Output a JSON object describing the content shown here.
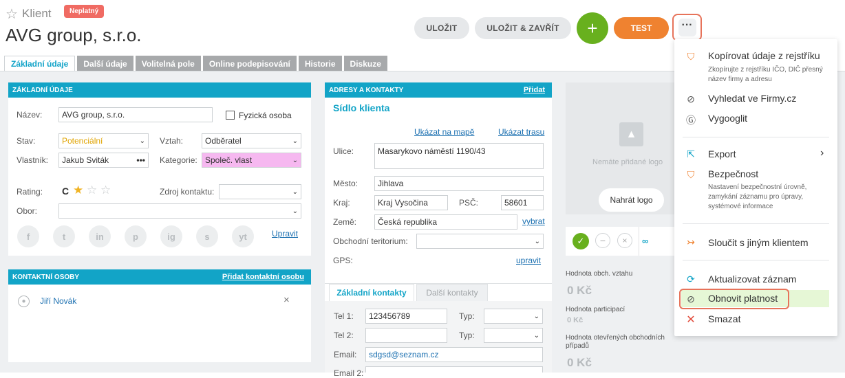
{
  "header": {
    "star_icon": "☆",
    "entity_label": "Klient",
    "status_badge": "Neplatný",
    "client_name": "AVG group, s.r.o.",
    "buttons": {
      "save": "ULOŽIT",
      "save_close": "ULOŽIT & ZAVŘÍT",
      "add": "+",
      "test": "TEST",
      "more": "···"
    },
    "tabs": [
      "Základní údaje",
      "Další údaje",
      "Volitelná pole",
      "Online podepisování",
      "Historie",
      "Diskuze"
    ]
  },
  "basic": {
    "title": "ZÁKLADNÍ ÚDAJE",
    "name_label": "Název:",
    "name_value": "AVG group, s.r.o.",
    "physical_label": "Fyzická osoba",
    "state_label": "Stav:",
    "state_value": "Potenciální",
    "relation_label": "Vztah:",
    "relation_value": "Odběratel",
    "owner_label": "Vlastník:",
    "owner_value": "Jakub Sviták",
    "category_label": "Kategorie:",
    "category_value": "Společ. vlast",
    "rating_label": "Rating:",
    "rating_value": "C",
    "rating_stars": 1,
    "source_label": "Zdroj kontaktu:",
    "field_label": "Obor:",
    "edit_link": "Upravit",
    "social": [
      "f",
      "t",
      "in",
      "p",
      "ig",
      "s",
      "yt"
    ]
  },
  "contacts": {
    "title": "KONTAKTNÍ OSOBY",
    "add_link": "Přidat kontaktní osobu",
    "person": "Jiří Novák",
    "remove": "×"
  },
  "address": {
    "title": "ADRESY A KONTAKTY",
    "add_link": "Přidat",
    "subtitle": "Sídlo klienta",
    "map_link": "Ukázat na mapě",
    "route_link": "Ukázat trasu",
    "street_label": "Ulice:",
    "street_value": "Masarykovo náměstí 1190/43",
    "city_label": "Město:",
    "city_value": "Jihlava",
    "region_label": "Kraj:",
    "region_value": "Kraj Vysočina",
    "zip_label": "PSČ:",
    "zip_value": "58601",
    "country_label": "Země:",
    "country_value": "Česká republika",
    "choose_link": "vybrat",
    "territory_label": "Obchodní teritorium:",
    "gps_label": "GPS:",
    "gps_link": "upravit",
    "tab_basic": "Základní kontakty",
    "tab_more": "Další kontakty",
    "tel1_label": "Tel 1:",
    "tel1_value": "123456789",
    "type_label": "Typ:",
    "tel2_label": "Tel 2:",
    "email_label": "Email:",
    "email_value": "sdgsd@seznam.cz",
    "email2_label": "Email 2:"
  },
  "logo": {
    "no_logo": "Nemáte přidané logo",
    "upload": "Nahrát logo"
  },
  "kpis": {
    "rel_label": "Hodnota obch. vztahu",
    "rel_value": "0 Kč",
    "part_label": "Hodnota participací",
    "part_value": "0 Kč",
    "open_label": "Hodnota otevřených obchodních případů",
    "open_value": "0 Kč"
  },
  "menu": {
    "copy_title": "Kopírovat údaje z rejstříku",
    "copy_desc": "Zkopírujte z rejstříku IČO, DIČ přesný název firmy a adresu",
    "find_firmy": "Vyhledat ve Firmy.cz",
    "google": "Vygooglit",
    "export": "Export",
    "security_title": "Bezpečnost",
    "security_desc": "Nastavení bezpečnostní úrovně, zamykání záznamu pro úpravy, systémové informace",
    "merge": "Sloučit s jiným klientem",
    "update": "Aktualizovat záznam",
    "restore": "Obnovit platnost",
    "delete": "Smazat"
  },
  "colors": {
    "accent": "#12a4c7",
    "green": "#68b01e",
    "orange": "#ef8230",
    "invalid_badge": "#f06b63",
    "highlight": "#e7735a"
  }
}
